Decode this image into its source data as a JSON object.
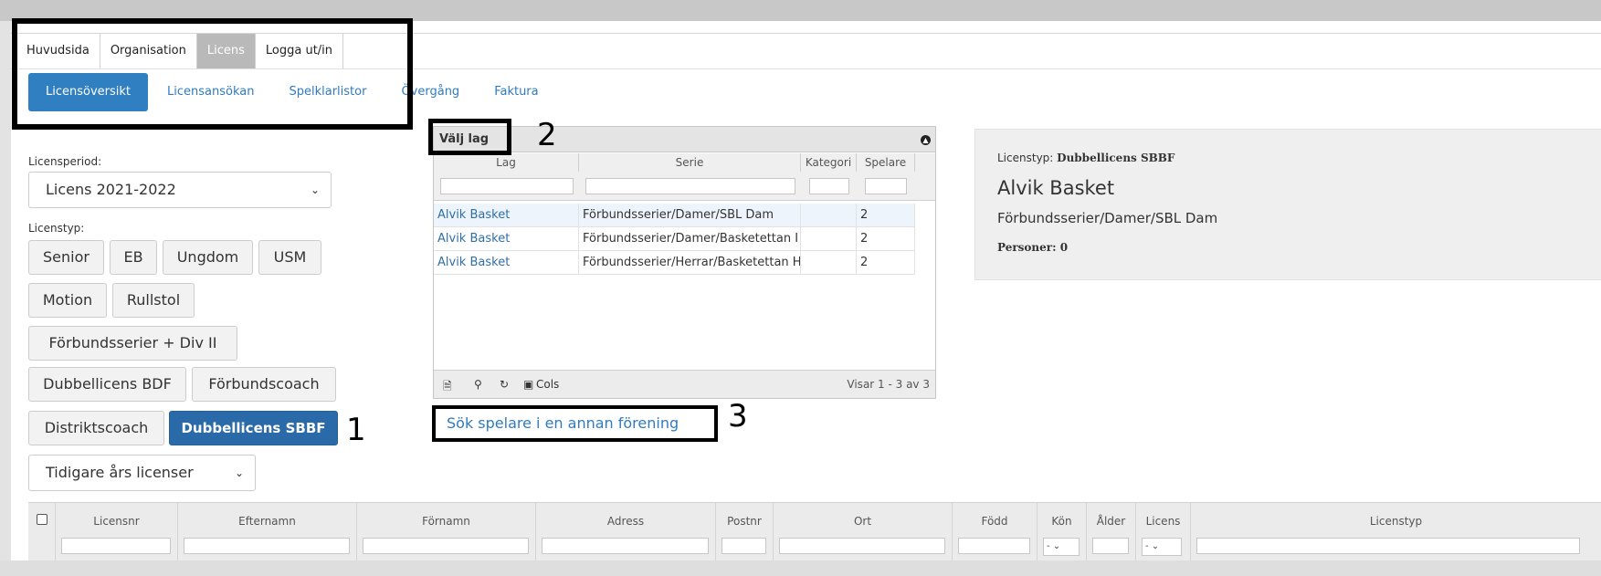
{
  "main_tabs": [
    {
      "label": "Huvudsida",
      "active": false
    },
    {
      "label": "Organisation",
      "active": false
    },
    {
      "label": "Licens",
      "active": true
    },
    {
      "label": "Logga ut/in",
      "active": false
    }
  ],
  "sub_tabs": [
    {
      "label": "Licensöversikt",
      "active": true
    },
    {
      "label": "Licensansökan",
      "active": false
    },
    {
      "label": "Spelklarlistor",
      "active": false
    },
    {
      "label": "Övergång",
      "active": false
    },
    {
      "label": "Faktura",
      "active": false
    }
  ],
  "period": {
    "label": "Licensperiod:",
    "value": "Licens 2021-2022"
  },
  "licenstyp": {
    "label": "Licenstyp:",
    "buttons": [
      "Senior",
      "EB",
      "Ungdom",
      "USM",
      "Motion",
      "Rullstol",
      "Förbundsserier + Div II",
      "Dubbellicens BDF",
      "Förbundscoach",
      "Distriktscoach",
      "Dubbellicens SBBF"
    ],
    "selected": "Dubbellicens SBBF"
  },
  "previous": {
    "value": "Tidigare års licenser"
  },
  "annotations": {
    "one": "1",
    "two": "2",
    "three": "3"
  },
  "team_grid": {
    "title": "Välj lag",
    "columns": [
      "Lag",
      "Serie",
      "Kategori",
      "Spelare"
    ],
    "rows": [
      {
        "lag": "Alvik Basket",
        "serie": "Förbundsserier/Damer/SBL Dam",
        "kategori": "",
        "spelare": "2"
      },
      {
        "lag": "Alvik Basket",
        "serie": "Förbundsserier/Damer/Basketettan I",
        "kategori": "",
        "spelare": "2"
      },
      {
        "lag": "Alvik Basket",
        "serie": "Förbundsserier/Herrar/Basketettan H",
        "kategori": "",
        "spelare": "2"
      }
    ],
    "footer_cols": "Cols",
    "footer_info": "Visar 1 - 3 av 3"
  },
  "search_link": "Sök spelare i en annan förening",
  "info_panel": {
    "type_label": "Licenstyp:",
    "type_value": "Dubbellicens SBBF",
    "team": "Alvik Basket",
    "serie": "Förbundsserier/Damer/SBL Dam",
    "persons": "Personer: 0"
  },
  "table": {
    "columns": [
      "Licensnr",
      "Efternamn",
      "Förnamn",
      "Adress",
      "Postnr",
      "Ort",
      "Född",
      "Kön",
      "Ålder",
      "Licens",
      "Licenstyp"
    ],
    "select_default": "-"
  },
  "colors": {
    "accent": "#2f7fc1",
    "selected_button": "#2a6aa8",
    "link": "#2f7bbf"
  }
}
